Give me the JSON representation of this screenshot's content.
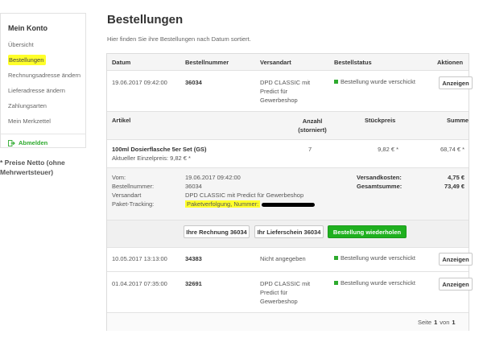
{
  "sidebar": {
    "title": "Mein Konto",
    "items": [
      {
        "label": "Übersicht",
        "active": false
      },
      {
        "label": "Bestellungen",
        "active": true
      },
      {
        "label": "Rechnungsadresse ändern",
        "active": false
      },
      {
        "label": "Lieferadresse ändern",
        "active": false
      },
      {
        "label": "Zahlungsarten",
        "active": false
      },
      {
        "label": "Mein Merkzettel",
        "active": false
      }
    ],
    "logout_label": "Abmelden",
    "note": "* Preise Netto (ohne Mehrwertsteuer)"
  },
  "page": {
    "title": "Bestellungen",
    "subtitle": "Hier finden Sie ihre Bestellungen nach Datum sortiert."
  },
  "orders_table": {
    "headers": {
      "date": "Datum",
      "order_no": "Bestellnummer",
      "shipping": "Versandart",
      "status": "Bestellstatus",
      "actions": "Aktionen"
    },
    "show_label": "Anzeigen",
    "orders": [
      {
        "date": "19.06.2017 09:42:00",
        "order_no": "36034",
        "shipping": "DPD CLASSIC mit Predict für Gewerbeshop",
        "status": "Bestellung wurde verschickt"
      },
      {
        "date": "10.05.2017 13:13:00",
        "order_no": "34383",
        "shipping": "Nicht angegeben",
        "status": "Bestellung wurde verschickt"
      },
      {
        "date": "01.04.2017 07:35:00",
        "order_no": "32691",
        "shipping": "DPD CLASSIC mit Predict für Gewerbeshop",
        "status": "Bestellung wurde verschickt"
      }
    ]
  },
  "details": {
    "headers": {
      "article": "Artikel",
      "quantity": "Anzahl (storniert)",
      "unit_price": "Stückpreis",
      "sum": "Summe"
    },
    "item": {
      "name": "100ml Dosierflasche 5er Set (GS)",
      "current_price": "Aktueller Einzelpreis: 9,82 € *",
      "quantity": "7",
      "unit_price": "9,82 € *",
      "sum": "68,74 € *"
    },
    "info": {
      "from_label": "Vom:",
      "from_value": "19.06.2017 09:42:00",
      "order_no_label": "Bestellnummer:",
      "order_no_value": "36034",
      "shipping_label": "Versandart",
      "shipping_value": "DPD CLASSIC mit Predict für Gewerbeshop",
      "tracking_label": "Paket-Tracking:",
      "tracking_value": "Paketverfolgung, Nummer:",
      "shipping_cost_label": "Versandkosten:",
      "shipping_cost_value": "4,75 €",
      "total_label": "Gesamtsumme:",
      "total_value": "73,49 €"
    },
    "buttons": {
      "invoice": "Ihre Rechnung 36034",
      "delivery_note": "Ihr Lieferschein 36034",
      "reorder": "Bestellung wiederholen"
    }
  },
  "pagination": {
    "label": "Seite",
    "current": "1",
    "of_label": "von",
    "total": "1"
  },
  "colors": {
    "accent_green": "#1fb01f",
    "highlight_yellow": "#ffff2a"
  }
}
